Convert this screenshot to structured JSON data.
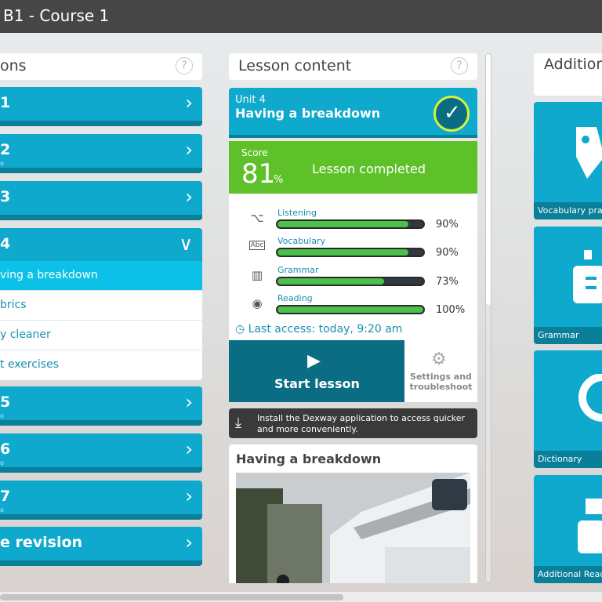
{
  "header": {
    "title": "B1 - Course 1"
  },
  "lessons": {
    "heading": "ons",
    "help": "?",
    "units": [
      {
        "label": "1",
        "arrow": "›",
        "dot": ""
      },
      {
        "label": "2",
        "arrow": "›",
        "dot": "o"
      },
      {
        "label": "3",
        "arrow": "›",
        "dot": ""
      },
      {
        "label": "4",
        "arrow": "∨",
        "dot": ""
      },
      {
        "label": "5",
        "arrow": "›",
        "dot": "o"
      },
      {
        "label": "6",
        "arrow": "›",
        "dot": "o"
      },
      {
        "label": "7",
        "arrow": "›",
        "dot": "o"
      },
      {
        "label": "e revision",
        "arrow": "›",
        "dot": ""
      }
    ],
    "sub_items": [
      "ving a breakdown",
      "brics",
      "y cleaner",
      "t exercises"
    ]
  },
  "content": {
    "heading": "Lesson content",
    "help": "?",
    "unit_label": "Unit 4",
    "lesson_title": "Having a breakdown",
    "check": "✓",
    "score_label": "Score",
    "score_value": "81",
    "score_unit": "%",
    "completed": "Lesson completed",
    "skills": [
      {
        "name": "Listening",
        "icon": "⌥",
        "value": 90,
        "pct": "90%"
      },
      {
        "name": "Vocabulary",
        "icon": "Abc",
        "value": 90,
        "pct": "90%"
      },
      {
        "name": "Grammar",
        "icon": "▥",
        "value": 73,
        "pct": "73%"
      },
      {
        "name": "Reading",
        "icon": "◉",
        "value": 100,
        "pct": "100%"
      }
    ],
    "last_access": "Last access: today, 9:20 am",
    "start_label": "Start lesson",
    "settings_label": "Settings and troubleshoot",
    "install_text": "Install the Dexway application to access quicker and more conveniently.",
    "picture_title": "Having a breakdown"
  },
  "activities": {
    "heading": "Addition activitie",
    "items": [
      {
        "label": "Vocabulary pra"
      },
      {
        "label": "Grammar"
      },
      {
        "label": "Dictionary"
      },
      {
        "label": "Additional Read"
      }
    ]
  },
  "colors": {
    "accent": "#0ea9cc",
    "dark_accent": "#0a7f9a",
    "success": "#5fc12a",
    "primary_button": "#0a6d84"
  }
}
